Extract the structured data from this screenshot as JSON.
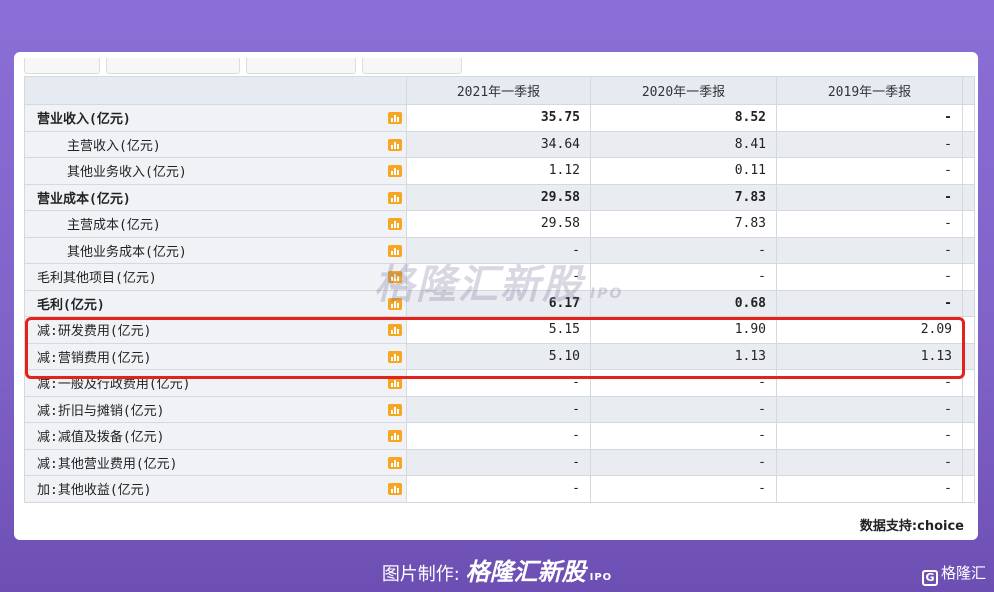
{
  "columns": [
    "",
    "2021年一季报",
    "2020年一季报",
    "2019年一季报"
  ],
  "rows": [
    {
      "label": "营业收入(亿元)",
      "bold": true,
      "indent": false,
      "v": [
        "35.75",
        "8.52",
        "-"
      ]
    },
    {
      "label": "主营收入(亿元)",
      "bold": false,
      "indent": true,
      "v": [
        "34.64",
        "8.41",
        "-"
      ]
    },
    {
      "label": "其他业务收入(亿元)",
      "bold": false,
      "indent": true,
      "v": [
        "1.12",
        "0.11",
        "-"
      ]
    },
    {
      "label": "营业成本(亿元)",
      "bold": true,
      "indent": false,
      "v": [
        "29.58",
        "7.83",
        "-"
      ]
    },
    {
      "label": "主营成本(亿元)",
      "bold": false,
      "indent": true,
      "v": [
        "29.58",
        "7.83",
        "-"
      ]
    },
    {
      "label": "其他业务成本(亿元)",
      "bold": false,
      "indent": true,
      "v": [
        "-",
        "-",
        "-"
      ]
    },
    {
      "label": "毛利其他项目(亿元)",
      "bold": false,
      "indent": false,
      "v": [
        "-",
        "-",
        "-"
      ]
    },
    {
      "label": "毛利(亿元)",
      "bold": true,
      "indent": false,
      "v": [
        "6.17",
        "0.68",
        "-"
      ]
    },
    {
      "label": "减:研发费用(亿元)",
      "bold": false,
      "indent": false,
      "v": [
        "5.15",
        "1.90",
        "2.09"
      ]
    },
    {
      "label": "减:营销费用(亿元)",
      "bold": false,
      "indent": false,
      "v": [
        "5.10",
        "1.13",
        "1.13"
      ]
    },
    {
      "label": "减:一般及行政费用(亿元)",
      "bold": false,
      "indent": false,
      "v": [
        "-",
        "-",
        "-"
      ]
    },
    {
      "label": "减:折旧与摊销(亿元)",
      "bold": false,
      "indent": false,
      "v": [
        "-",
        "-",
        "-"
      ]
    },
    {
      "label": "减:减值及拨备(亿元)",
      "bold": false,
      "indent": false,
      "v": [
        "-",
        "-",
        "-"
      ]
    },
    {
      "label": "减:其他营业费用(亿元)",
      "bold": false,
      "indent": false,
      "v": [
        "-",
        "-",
        "-"
      ]
    },
    {
      "label": "加:其他收益(亿元)",
      "bold": false,
      "indent": false,
      "v": [
        "-",
        "-",
        "-"
      ]
    }
  ],
  "watermark": {
    "brand": "格隆汇新股",
    "sub": "IPO"
  },
  "source": "数据支持:choice",
  "credit": {
    "prefix": "图片制作:",
    "brand": "格隆汇新股",
    "sub": "IPO"
  },
  "corner_logo": {
    "mark": "G",
    "text": "格隆汇"
  },
  "icons": {
    "row_chart": "bar-chart-icon"
  },
  "colors": {
    "highlight": "#e5211b",
    "icon": "#f5a623",
    "background": "#8b6fd6"
  }
}
